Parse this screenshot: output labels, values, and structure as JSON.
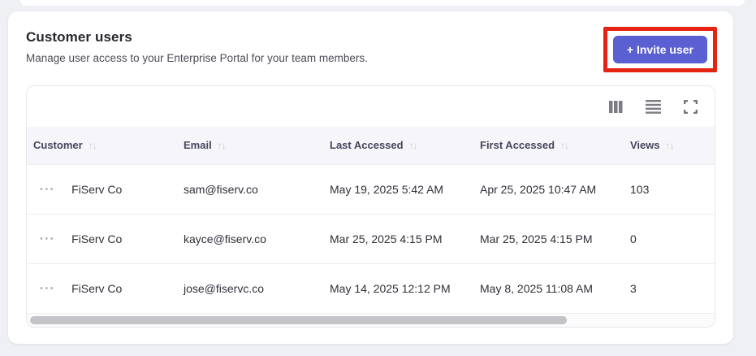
{
  "colors": {
    "page_bg": "#eef0f3",
    "accent": "#5a5fd1",
    "annotation_red": "#e42313",
    "header_bg": "#f6f6fa"
  },
  "panel": {
    "title": "Customer users",
    "subtitle": "Manage user access to your Enterprise Portal for your team members.",
    "invite_button_label": "+ Invite user"
  },
  "toolbar": {
    "icons": [
      "columns-icon",
      "rows-density-icon",
      "fullscreen-icon"
    ]
  },
  "table": {
    "sort_glyph": "↑↓",
    "row_menu_glyph": "•••",
    "columns": [
      {
        "label": "Customer",
        "sortable": true
      },
      {
        "label": "Email",
        "sortable": true
      },
      {
        "label": "Last Accessed",
        "sortable": true
      },
      {
        "label": "First Accessed",
        "sortable": true
      },
      {
        "label": "Views",
        "sortable": true
      }
    ],
    "rows": [
      {
        "customer": "FiServ Co",
        "email": "sam@fiserv.co",
        "last_accessed": "May 19, 2025 5:42 AM",
        "first_accessed": "Apr 25, 2025 10:47 AM",
        "views": "103"
      },
      {
        "customer": "FiServ Co",
        "email": "kayce@fiserv.co",
        "last_accessed": "Mar 25, 2025 4:15 PM",
        "first_accessed": "Mar 25, 2025 4:15 PM",
        "views": "0"
      },
      {
        "customer": "FiServ Co",
        "email": "jose@fiservc.co",
        "last_accessed": "May 14, 2025 12:12 PM",
        "first_accessed": "May 8, 2025 11:08 AM",
        "views": "3"
      }
    ],
    "scrollbar": {
      "thumb_percent": 78
    }
  }
}
